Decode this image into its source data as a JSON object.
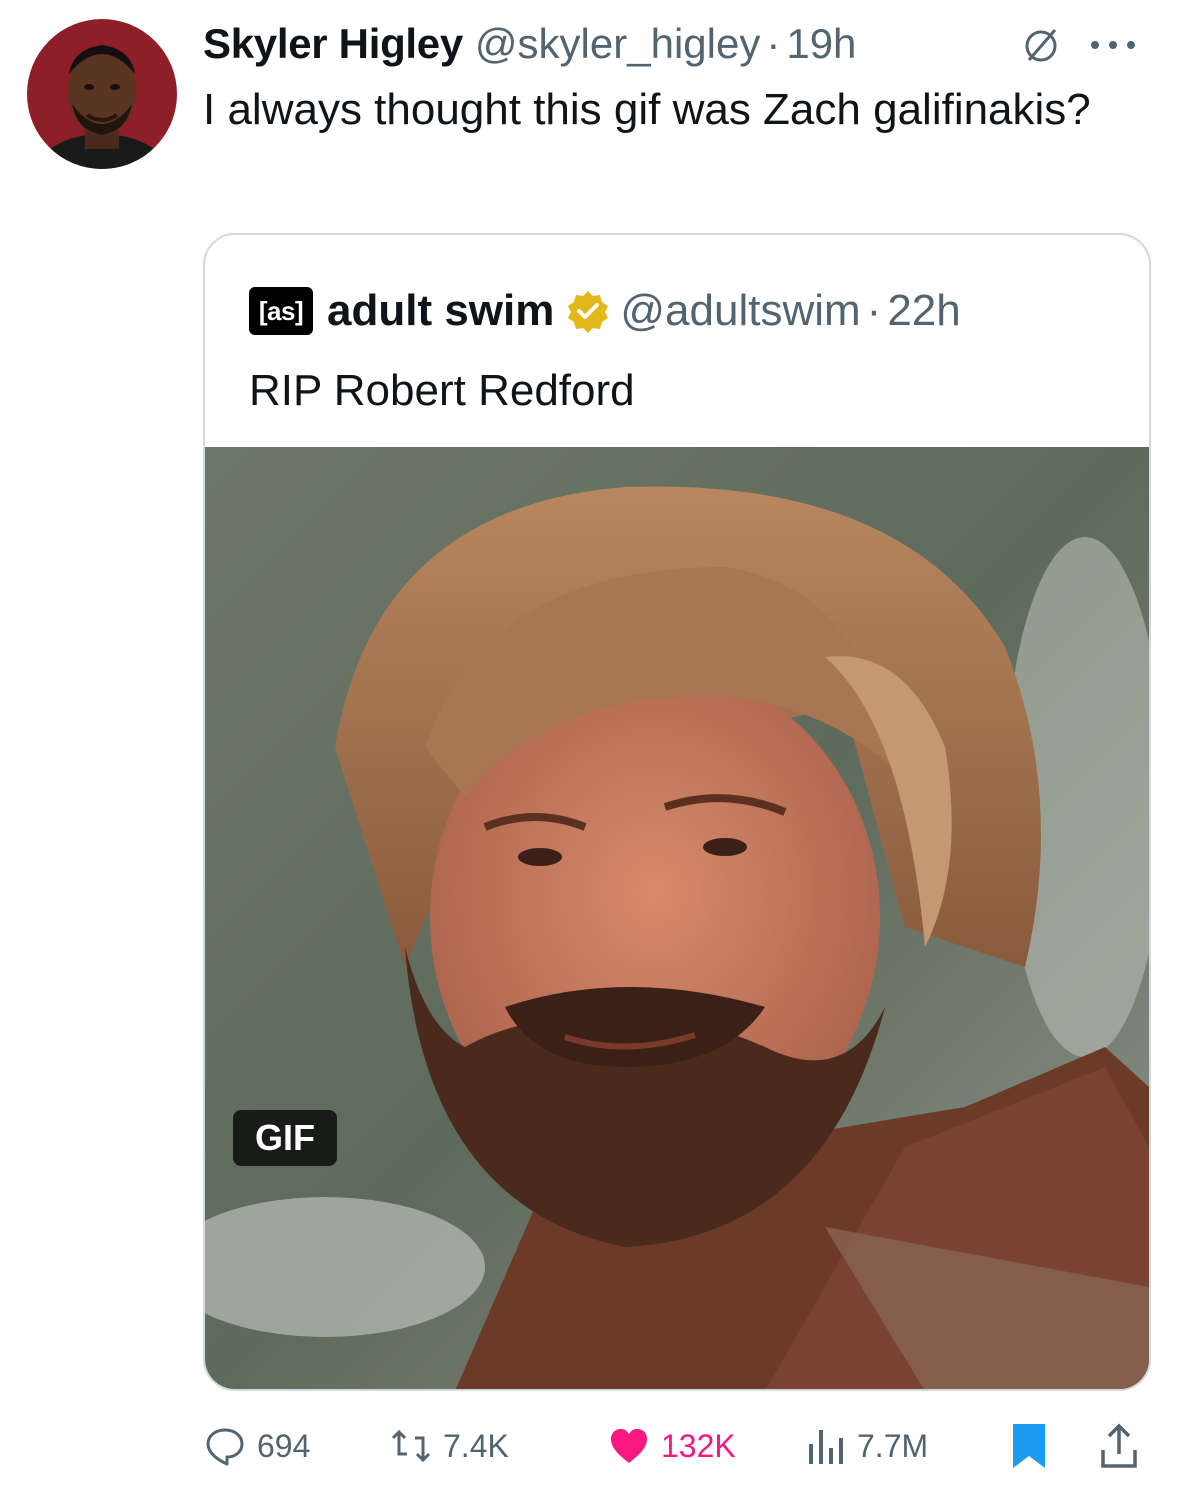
{
  "tweet": {
    "author_name": "Skyler Higley",
    "author_handle": "@skyler_higley",
    "separator": "·",
    "time": "19h",
    "text": "I always thought this gif was Zach galifinakis?"
  },
  "quoted_tweet": {
    "logo_text": "[as]",
    "author_name": "adult swim",
    "author_handle": "@adultswim",
    "separator": "·",
    "time": "22h",
    "text": "RIP Robert Redford",
    "media_badge": "GIF"
  },
  "metrics": {
    "replies": "694",
    "reposts": "7.4K",
    "likes": "132K",
    "views": "7.7M"
  },
  "icons": {
    "grok": "grok-icon",
    "more": "more-icon",
    "verified": "verified-badge-icon",
    "reply": "reply-icon",
    "repost": "repost-icon",
    "like": "heart-icon",
    "views": "analytics-icon",
    "bookmark": "bookmark-icon",
    "share": "share-icon"
  },
  "colors": {
    "text_primary": "#0f1419",
    "text_secondary": "#536471",
    "like_active": "#f91880",
    "bookmark_active": "#1d9bf0",
    "verified_gold": "#e2b719"
  }
}
